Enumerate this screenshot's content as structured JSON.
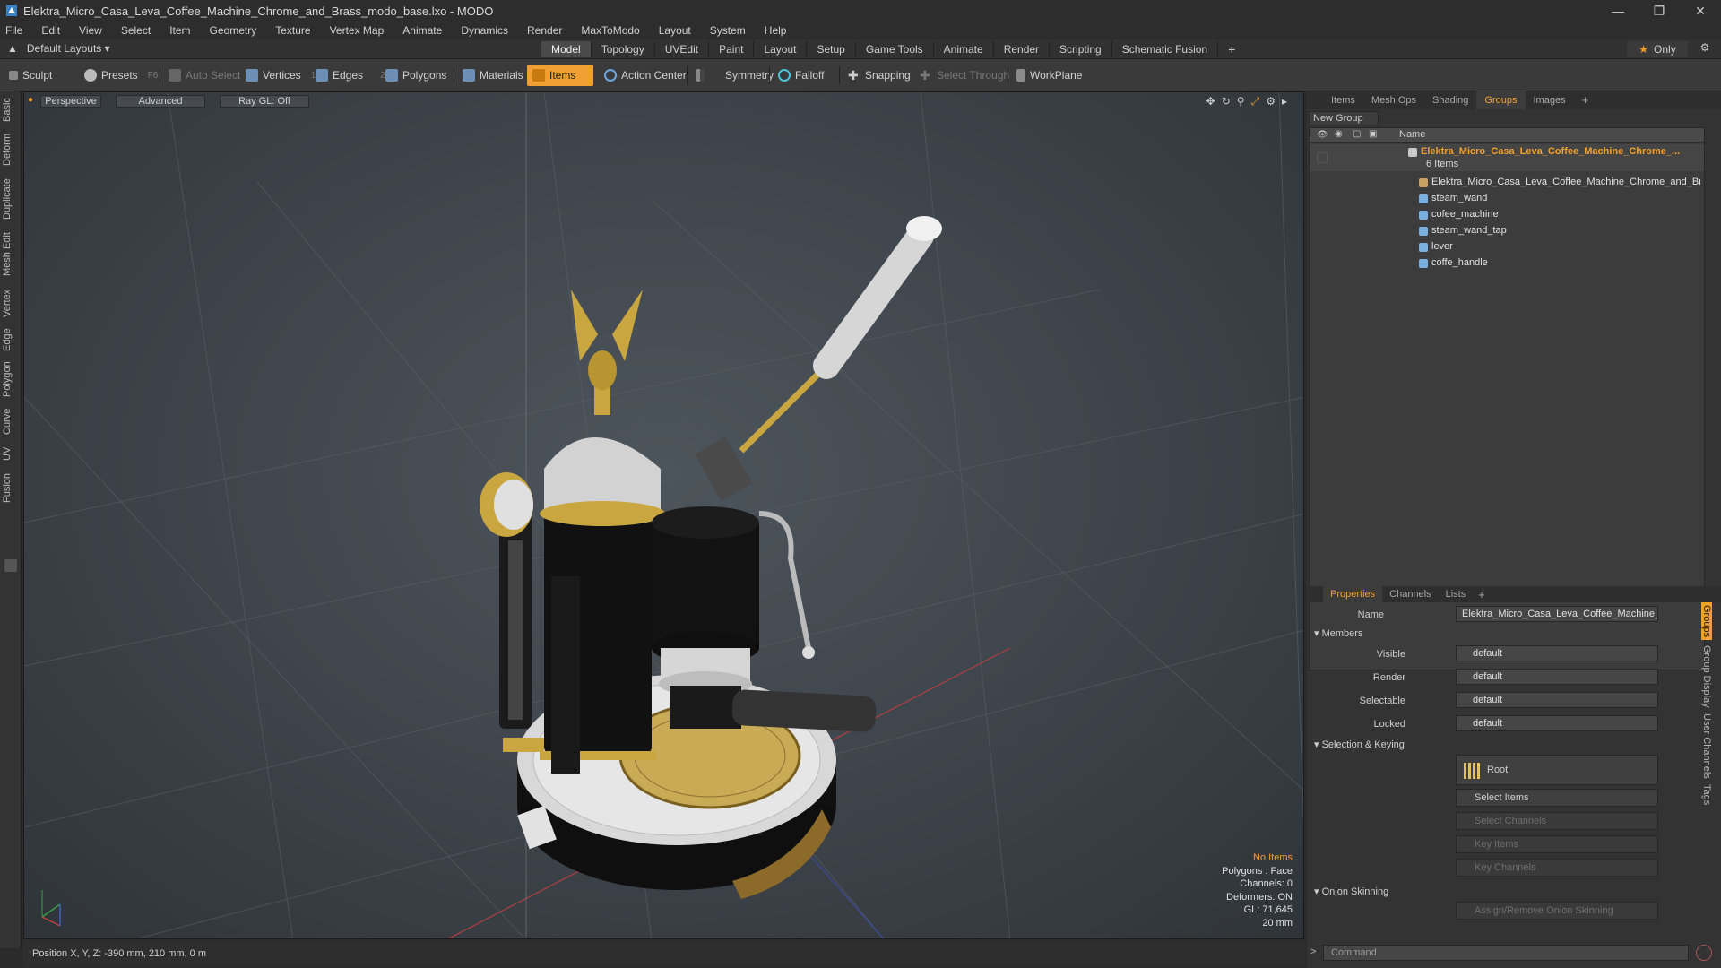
{
  "window": {
    "title": "Elektra_Micro_Casa_Leva_Coffee_Machine_Chrome_and_Brass_modo_base.lxo - MODO"
  },
  "menu": [
    "File",
    "Edit",
    "View",
    "Select",
    "Item",
    "Geometry",
    "Texture",
    "Vertex Map",
    "Animate",
    "Dynamics",
    "Render",
    "MaxToModo",
    "Layout",
    "System",
    "Help"
  ],
  "layout": {
    "selector": "Default Layouts",
    "tabs": [
      "Model",
      "Topology",
      "UVEdit",
      "Paint",
      "Layout",
      "Setup",
      "Game Tools",
      "Animate",
      "Render",
      "Scripting",
      "Schematic Fusion"
    ],
    "active_tab": "Model",
    "only_label": "Only"
  },
  "toolbar": {
    "sculpt": "Sculpt",
    "presets": "Presets",
    "presets_key": "F6",
    "auto_select": "Auto Select",
    "vertices": "Vertices",
    "vertices_count": "1",
    "edges": "Edges",
    "edges_count": "2",
    "polygons": "Polygons",
    "materials": "Materials",
    "items": "Items",
    "action_center": "Action Center",
    "symmetry": "Symmetry",
    "falloff": "Falloff",
    "snapping": "Snapping",
    "select_through": "Select Through",
    "workplane": "WorkPlane"
  },
  "left_tabs": [
    "Basic",
    "Deform",
    "Duplicate",
    "Mesh Edit",
    "Vertex",
    "Edge",
    "Polygon",
    "Curve",
    "UV",
    "Fusion"
  ],
  "viewport": {
    "view": "Perspective",
    "shading": "Advanced",
    "raygl": "Ray GL: Off",
    "info": {
      "no_items": "No Items",
      "polygons": "Polygons : Face",
      "channels": "Channels: 0",
      "deformers": "Deformers: ON",
      "gl": "GL: 71,645",
      "scale": "20 mm"
    }
  },
  "status": {
    "position": "Position X, Y, Z:  -390 mm, 210 mm, 0 m"
  },
  "right_panel": {
    "top_tabs": [
      "Items",
      "Mesh Ops",
      "Shading",
      "Groups",
      "Images"
    ],
    "active_top_tab": "Groups",
    "new_group": "New Group",
    "name_col": "Name",
    "group_name": "Elektra_Micro_Casa_Leva_Coffee_Machine_Chrome_...",
    "group_count": "6 Items",
    "members": [
      "Elektra_Micro_Casa_Leva_Coffee_Machine_Chrome_and_Br...",
      "steam_wand",
      "cofee_machine",
      "steam_wand_tap",
      "lever",
      "coffe_handle"
    ],
    "bottom_tabs": [
      "Properties",
      "Channels",
      "Lists"
    ],
    "active_bottom_tab": "Properties",
    "props": {
      "name_label": "Name",
      "name_value": "Elektra_Micro_Casa_Leva_Coffee_Machine_Chrome_",
      "members_section": "Members",
      "visible_label": "Visible",
      "visible_value": "default",
      "render_label": "Render",
      "render_value": "default",
      "selectable_label": "Selectable",
      "selectable_value": "default",
      "locked_label": "Locked",
      "locked_value": "default",
      "sel_key_section": "Selection & Keying",
      "root": "Root",
      "select_items": "Select Items",
      "select_channels": "Select Channels",
      "key_items": "Key Items",
      "key_channels": "Key Channels",
      "onion_section": "Onion Skinning",
      "onion_button": "Assign/Remove Onion Skinning"
    },
    "side_tabs": [
      "Groups",
      "Group Display",
      "User Channels",
      "Tags"
    ],
    "command_placeholder": "Command"
  },
  "colors": {
    "accent": "#f0a030",
    "panel": "#333333",
    "viewport_center": "#4d555c"
  }
}
